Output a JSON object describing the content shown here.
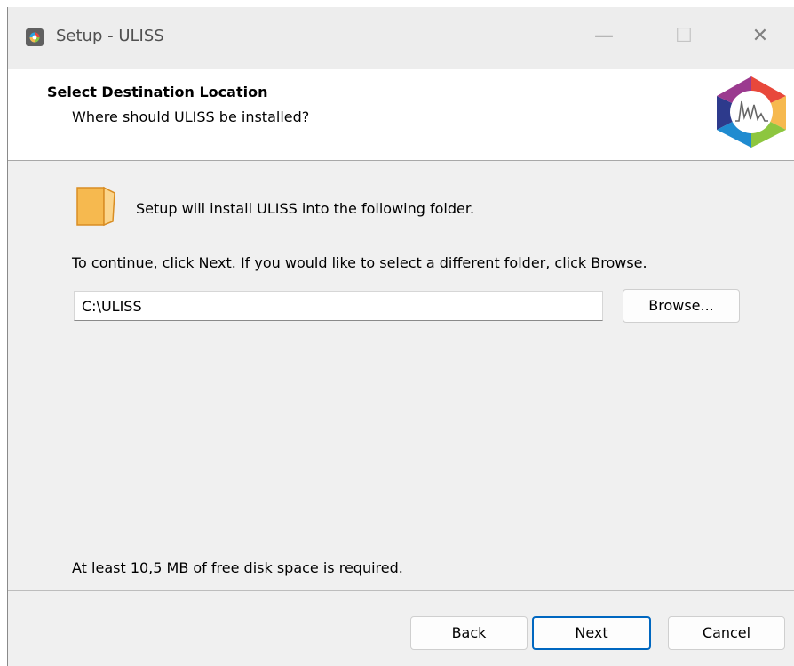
{
  "window": {
    "title": "Setup - ULISS",
    "controls": {
      "minimize": "—",
      "maximize": "☐",
      "close": "✕"
    }
  },
  "header": {
    "title": "Select Destination Location",
    "subtitle": "Where should ULISS be installed?"
  },
  "content": {
    "intro": "Setup will install ULISS into the following folder.",
    "instructions": "To continue, click Next. If you would like to select a different folder, click Browse.",
    "path_value": "C:\\ULISS",
    "browse_label": "Browse...",
    "disk_space": "At least 10,5 MB of free disk space is required."
  },
  "footer": {
    "back_label": "Back",
    "next_label": "Next",
    "cancel_label": "Cancel"
  },
  "icons": {
    "app": "uliss-app-icon",
    "logo": "uliss-logo-icon",
    "folder": "folder-icon"
  },
  "colors": {
    "accent": "#0067c0",
    "folder": "#f6b94f",
    "window_bg": "#f0f0f0"
  }
}
